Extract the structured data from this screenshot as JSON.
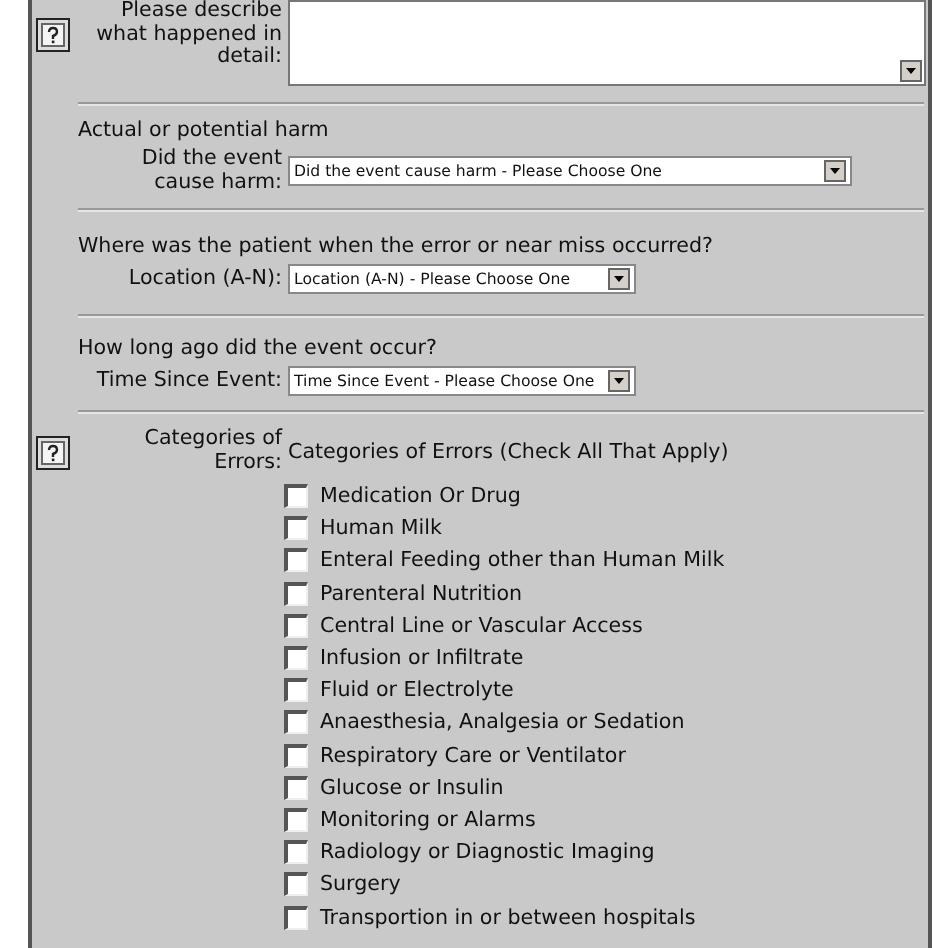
{
  "description": {
    "label": "Please describe what happened in detail:"
  },
  "harm": {
    "heading": "Actual or potential harm",
    "label": "Did the event cause harm:",
    "value": "Did the event cause harm - Please Choose One"
  },
  "location": {
    "heading": "Where was the patient when the error or near miss occurred?",
    "label": "Location (A-N):",
    "value": "Location (A-N) - Please Choose One"
  },
  "time": {
    "heading": "How long ago did the event occur?",
    "label": "Time Since Event:",
    "value": "Time Since Event - Please Choose One"
  },
  "categories": {
    "label": "Categories of Errors:",
    "heading": "Categories of Errors (Check All That Apply)",
    "items": [
      {
        "label": "Medication Or Drug",
        "checked": false
      },
      {
        "label": "Human Milk",
        "checked": false
      },
      {
        "label": "Enteral Feeding other than Human Milk",
        "checked": false
      },
      {
        "label": "Parenteral Nutrition",
        "checked": false
      },
      {
        "label": "Central Line or Vascular Access",
        "checked": false
      },
      {
        "label": "Infusion or Infiltrate",
        "checked": false
      },
      {
        "label": "Fluid or Electrolyte",
        "checked": false
      },
      {
        "label": "Anaesthesia, Analgesia or Sedation",
        "checked": false
      },
      {
        "label": "Respiratory Care or Ventilator",
        "checked": false
      },
      {
        "label": "Glucose or Insulin",
        "checked": false
      },
      {
        "label": "Monitoring or Alarms",
        "checked": false
      },
      {
        "label": "Radiology or Diagnostic Imaging",
        "checked": false
      },
      {
        "label": "Surgery",
        "checked": false
      },
      {
        "label": "Transportion in or between hospitals",
        "checked": false
      }
    ]
  }
}
